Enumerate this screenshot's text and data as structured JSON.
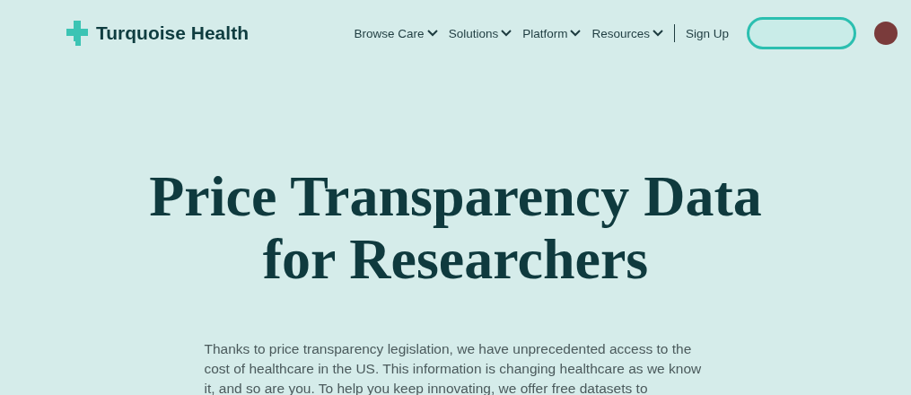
{
  "header": {
    "logo": "Turquoise Health",
    "nav": [
      {
        "label": "Browse Care",
        "dropdown": true
      },
      {
        "label": "Solutions",
        "dropdown": true
      },
      {
        "label": "Platform",
        "dropdown": true
      },
      {
        "label": "Resources",
        "dropdown": true
      },
      {
        "label": "Sign Up",
        "dropdown": false
      }
    ]
  },
  "hero": {
    "title_lines": [
      "Price Transparency Data",
      "for Researchers"
    ],
    "intro": "Thanks to price transparency legislation, we have unprecedented access to the cost of healthcare in the US. This information is changing healthcare as we know it, and so are you. To help you keep innovating, we offer free datasets to"
  }
}
